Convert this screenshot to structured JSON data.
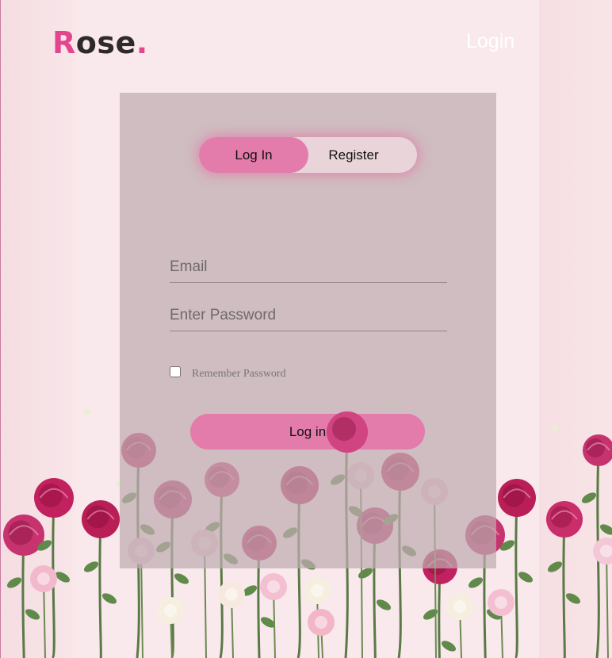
{
  "brand": {
    "logo_first": "R",
    "logo_rest": "ose",
    "logo_dot": "."
  },
  "nav": {
    "login_label": "Login"
  },
  "auth_toggle": {
    "login_label": "Log In",
    "register_label": "Register",
    "active": "login"
  },
  "form": {
    "email_placeholder": "Email",
    "password_placeholder": "Enter Password",
    "remember_label": "Remember Password",
    "remember_checked": false,
    "submit_label": "Log in"
  },
  "colors": {
    "accent": "#e2478e",
    "button": "#e37bab",
    "panel": "#beacb0"
  },
  "background": {
    "image": "pink-roses-on-pink-background"
  }
}
